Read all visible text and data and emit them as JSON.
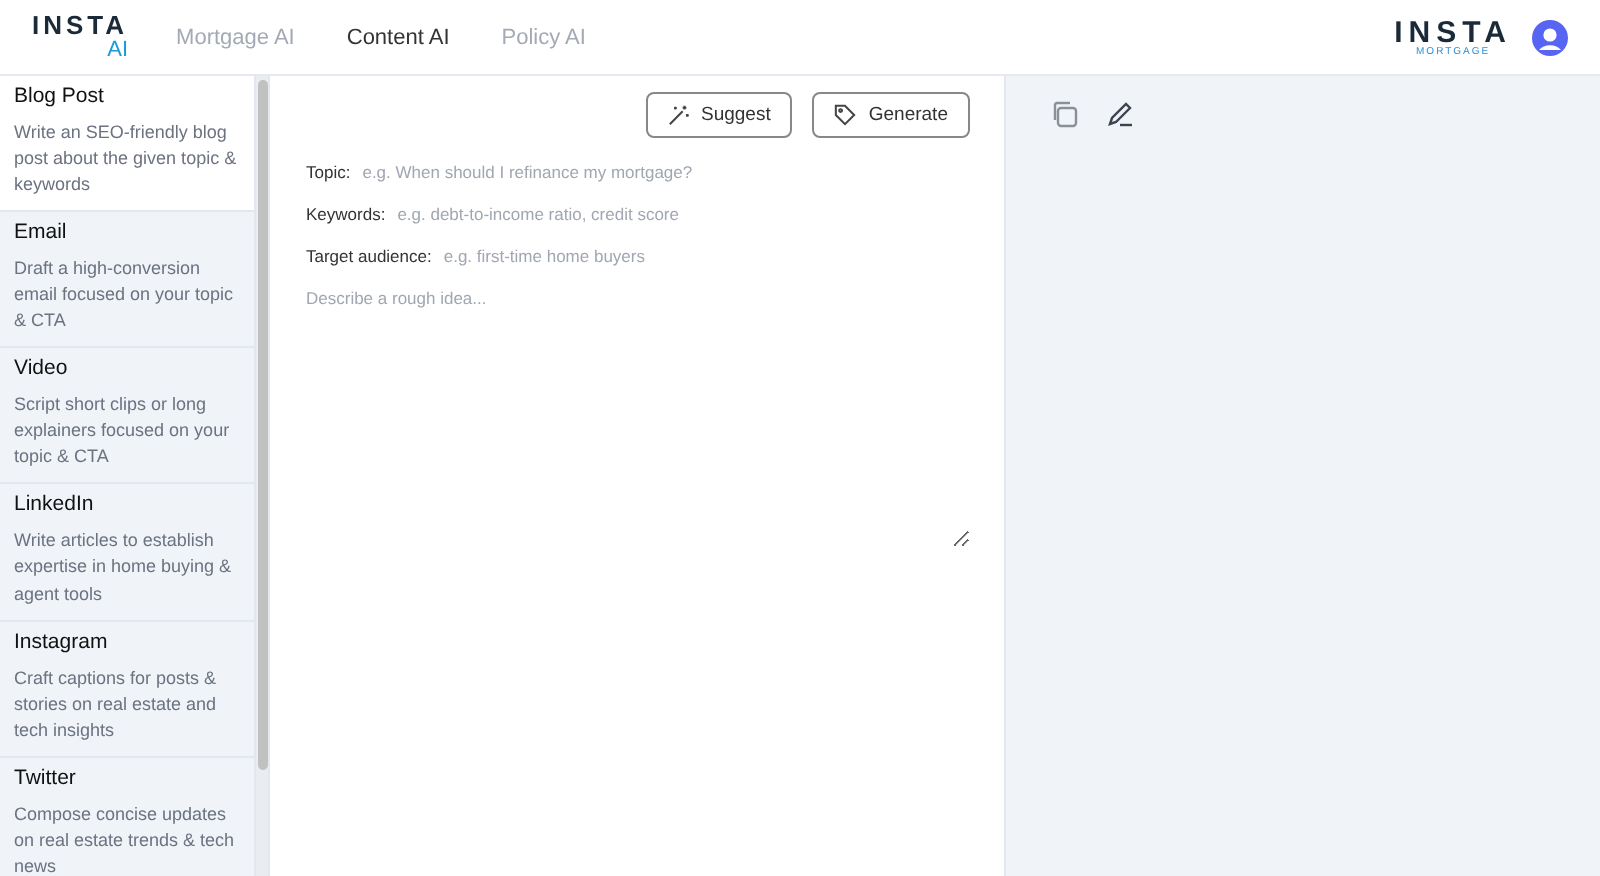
{
  "header": {
    "logo": {
      "word": "INSTA",
      "accent": "AI"
    },
    "tabs": [
      {
        "label": "Mortgage AI",
        "selected": false
      },
      {
        "label": "Content AI",
        "selected": true
      },
      {
        "label": "Policy AI",
        "selected": false
      }
    ],
    "brand": {
      "word": "INSTA",
      "sub": "MORTGAGE"
    }
  },
  "sidebar": {
    "items": [
      {
        "title": "Blog Post",
        "description": "Write an SEO-friendly blog post about the given topic & keywords",
        "selected": true
      },
      {
        "title": "Email",
        "description": "Draft a high-conversion email focused on your topic & CTA",
        "selected": false
      },
      {
        "title": "Video",
        "description": "Script short clips or long explainers focused on your topic & CTA",
        "selected": false
      },
      {
        "title": "LinkedIn",
        "description": "Write articles to establish expertise in home buying & agent tools",
        "selected": false
      },
      {
        "title": "Instagram",
        "description": "Craft captions for posts & stories on real estate and tech insights",
        "selected": false
      },
      {
        "title": "Twitter",
        "description": "Compose concise updates on real estate trends & tech news",
        "selected": false
      }
    ]
  },
  "editor": {
    "buttons": [
      {
        "label": "Suggest",
        "kind": "wand"
      },
      {
        "label": "Generate",
        "kind": "tag"
      }
    ],
    "fields": [
      {
        "label": "Topic:",
        "placeholder": "e.g. When should I refinance my mortgage?"
      },
      {
        "label": "Keywords:",
        "placeholder": "e.g. debt-to-income ratio, credit score"
      },
      {
        "label": "Target audience:",
        "placeholder": "e.g. first-time home buyers"
      }
    ],
    "idea": {
      "placeholder": "Describe a rough idea..."
    }
  },
  "output": {
    "tools": [
      {
        "kind": "copy"
      },
      {
        "kind": "edit"
      }
    ]
  }
}
